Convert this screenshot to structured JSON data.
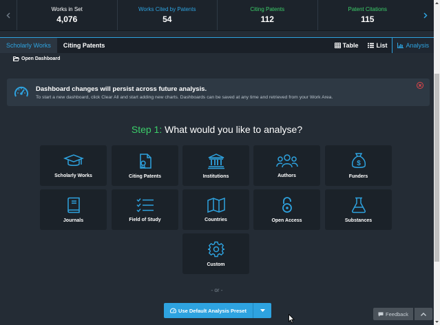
{
  "stats": [
    {
      "label": "Works in Set",
      "value": "4,076",
      "color": "white"
    },
    {
      "label": "Works Cited by Patents",
      "value": "54",
      "color": "blue"
    },
    {
      "label": "Citing Patents",
      "value": "112",
      "color": "green"
    },
    {
      "label": "Patent Citations",
      "value": "115",
      "color": "green"
    }
  ],
  "tabs": {
    "scholarly": "Scholarly Works",
    "citing": "Citing Patents",
    "table": "Table",
    "list": "List",
    "analysis": "Analysis"
  },
  "open_dashboard": "Open Dashboard",
  "banner": {
    "title": "Dashboard changes will persist across future analysis.",
    "subtitle": "To start a new dashboard, click Clear All and start adding new charts. Dashboards can be saved at any time and retrieved from your Work Area."
  },
  "step": {
    "number": "Step 1:",
    "question": " What would you like to analyse?"
  },
  "tiles": [
    {
      "label": "Scholarly Works",
      "icon": "graduation-cap-icon"
    },
    {
      "label": "Citing Patents",
      "icon": "certificate-icon"
    },
    {
      "label": "Institutions",
      "icon": "institution-icon"
    },
    {
      "label": "Authors",
      "icon": "users-icon"
    },
    {
      "label": "Funders",
      "icon": "money-bag-icon"
    },
    {
      "label": "Journals",
      "icon": "book-icon"
    },
    {
      "label": "Field of Study",
      "icon": "checklist-icon"
    },
    {
      "label": "Countries",
      "icon": "map-icon"
    },
    {
      "label": "Open Access",
      "icon": "open-lock-icon"
    },
    {
      "label": "Substances",
      "icon": "flask-icon"
    },
    {
      "label": "Custom",
      "icon": "gear-icon"
    }
  ],
  "or_text": "- or -",
  "preset_button": "Use Default Analysis Preset",
  "feedback": "Feedback",
  "colors": {
    "accent": "#2ea3e0",
    "green": "#3ccf6a",
    "background": "#242c35",
    "tile": "#1b2229",
    "close": "#e0454a"
  }
}
